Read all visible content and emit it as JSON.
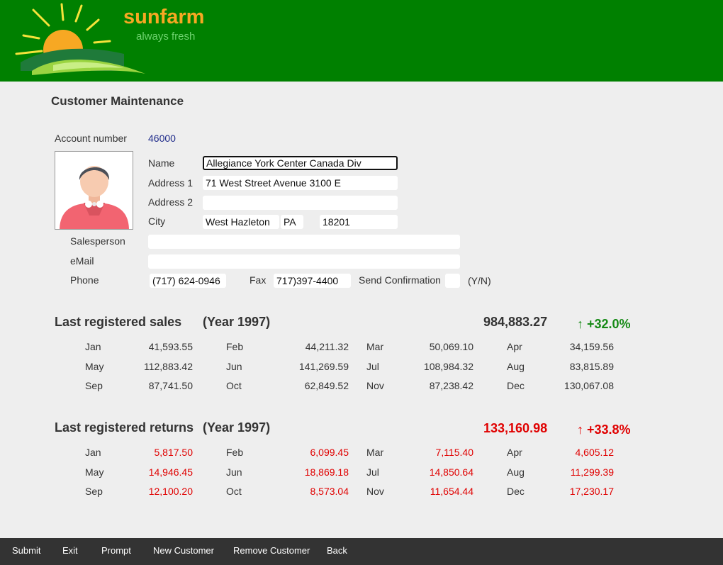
{
  "header": {
    "brand": "sunfarm",
    "tagline": "always fresh",
    "colors": {
      "bar": "#008000",
      "brand": "#f7a823",
      "tagline": "#6fd36f"
    }
  },
  "page": {
    "title": "Customer Maintenance"
  },
  "customer": {
    "account_label": "Account number",
    "account_value": "46000",
    "name_label": "Name",
    "name_value": "Allegiance York Center Canada Div",
    "address1_label": "Address 1",
    "address1_value": "71 West Street Avenue 3100 E",
    "address2_label": "Address 2",
    "address2_value": "",
    "city_label": "City",
    "city_value": "West Hazleton",
    "state_value": "PA",
    "zip_value": "18201",
    "salesperson_label": "Salesperson",
    "salesperson_value": "",
    "email_label": "eMail",
    "email_value": "",
    "phone_label": "Phone",
    "phone_value": "(717) 624-0946",
    "fax_label": "Fax",
    "fax_value": "717)397-4400",
    "confirm_label": "Send Confirmation",
    "confirm_value": "",
    "confirm_hint": "(Y/N)"
  },
  "sales": {
    "title": "Last registered sales",
    "year": "(Year 1997)",
    "total": "984,883.27",
    "change": "↑ +32.0%",
    "months": [
      {
        "m": "Jan",
        "v": "41,593.55"
      },
      {
        "m": "Feb",
        "v": "44,211.32"
      },
      {
        "m": "Mar",
        "v": "50,069.10"
      },
      {
        "m": "Apr",
        "v": "34,159.56"
      },
      {
        "m": "May",
        "v": "112,883.42"
      },
      {
        "m": "Jun",
        "v": "141,269.59"
      },
      {
        "m": "Jul",
        "v": "108,984.32"
      },
      {
        "m": "Aug",
        "v": "83,815.89"
      },
      {
        "m": "Sep",
        "v": "87,741.50"
      },
      {
        "m": "Oct",
        "v": "62,849.52"
      },
      {
        "m": "Nov",
        "v": "87,238.42"
      },
      {
        "m": "Dec",
        "v": "130,067.08"
      }
    ]
  },
  "returns": {
    "title": "Last registered returns",
    "year": "(Year 1997)",
    "total": "133,160.98",
    "change": "↑ +33.8%",
    "months": [
      {
        "m": "Jan",
        "v": "5,817.50"
      },
      {
        "m": "Feb",
        "v": "6,099.45"
      },
      {
        "m": "Mar",
        "v": "7,115.40"
      },
      {
        "m": "Apr",
        "v": "4,605.12"
      },
      {
        "m": "May",
        "v": "14,946.45"
      },
      {
        "m": "Jun",
        "v": "18,869.18"
      },
      {
        "m": "Jul",
        "v": "14,850.64"
      },
      {
        "m": "Aug",
        "v": "11,299.39"
      },
      {
        "m": "Sep",
        "v": "12,100.20"
      },
      {
        "m": "Oct",
        "v": "8,573.04"
      },
      {
        "m": "Nov",
        "v": "11,654.44"
      },
      {
        "m": "Dec",
        "v": "17,230.17"
      }
    ]
  },
  "footer": {
    "buttons": [
      "Submit",
      "Exit",
      "Prompt",
      "New Customer",
      "Remove Customer",
      "Back"
    ]
  }
}
